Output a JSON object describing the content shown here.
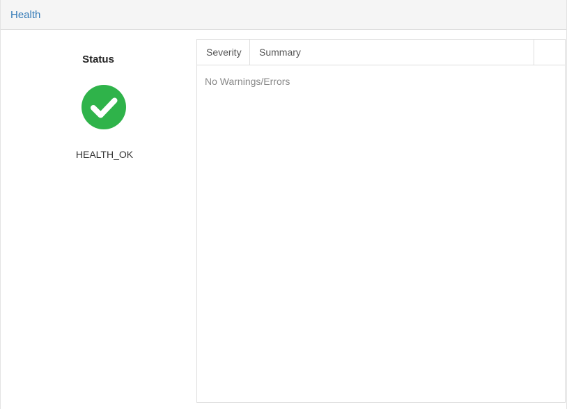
{
  "panel": {
    "title": "Health"
  },
  "status": {
    "heading": "Status",
    "value": "HEALTH_OK",
    "icon": "check-circle-icon",
    "icon_color": "#2fb34a"
  },
  "table": {
    "columns": [
      "Severity",
      "Summary",
      ""
    ],
    "empty_message": "No Warnings/Errors"
  },
  "colors": {
    "title_link": "#337ab7",
    "heading_bg": "#f5f5f5",
    "border": "#dddddd"
  }
}
